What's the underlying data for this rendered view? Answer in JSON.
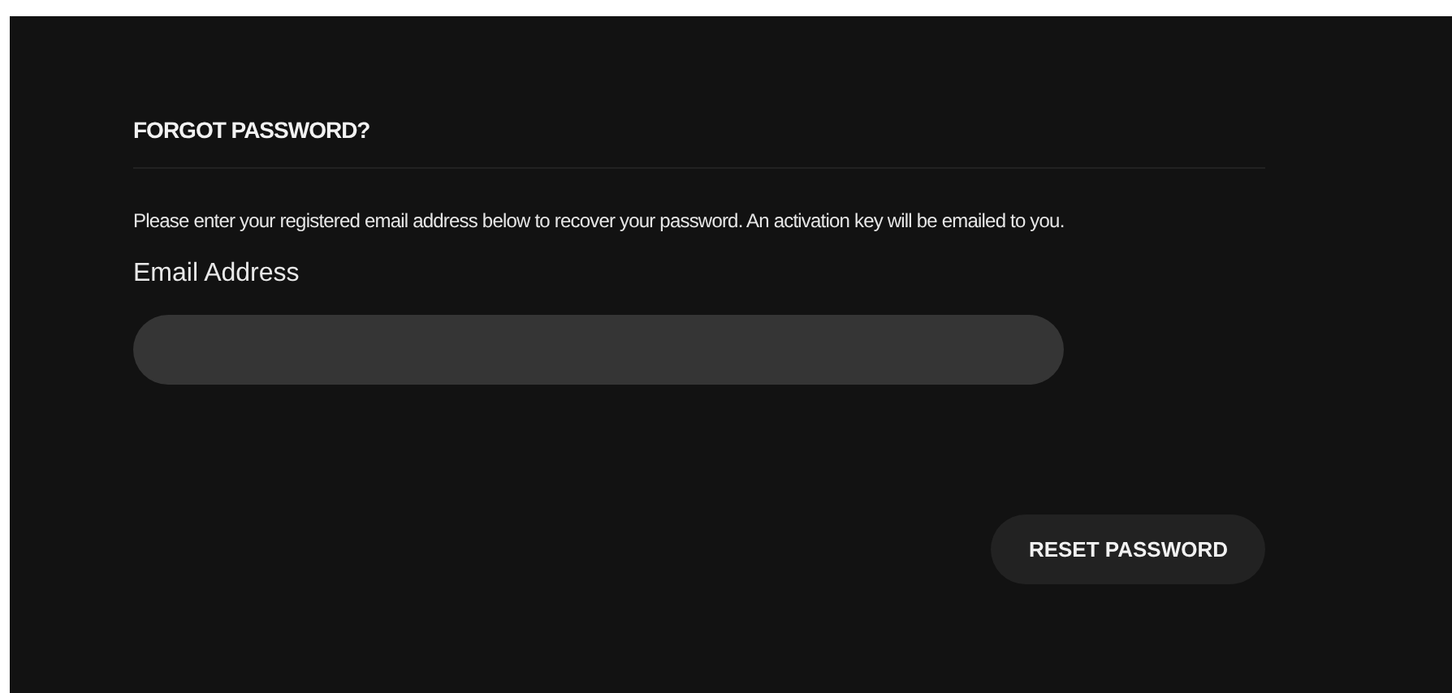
{
  "title": "FORGOT PASSWORD?",
  "instructions": "Please enter your registered email address below to recover your password. An activation key will be emailed to you.",
  "email_field": {
    "label": "Email Address"
  },
  "buttons": [
    "RESET PASSWORD"
  ]
}
